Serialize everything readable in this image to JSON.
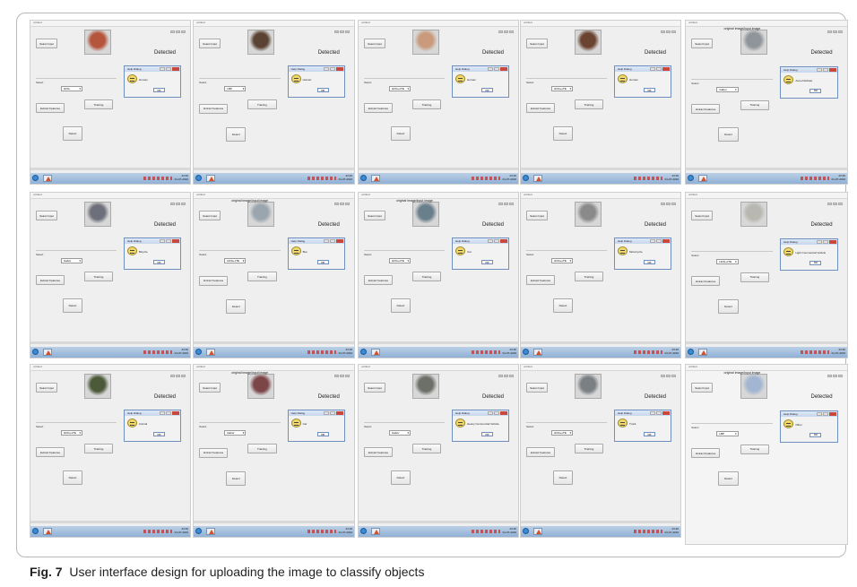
{
  "caption": {
    "fig_label": "Fig. 7",
    "text": "User interface design for uploading the image to classify objects"
  },
  "ui": {
    "window_title": "untitled",
    "select_input": "Select Input",
    "select_label": "Select",
    "extract_features": "Extract Features",
    "training": "Training",
    "detect": "Detect",
    "detected": "Detected",
    "dialog_title": "Help Dialog",
    "ok": "OK",
    "clock_time": "23:30",
    "clock_date": "01-07-2016"
  },
  "panels": [
    {
      "dropdown": "HOG",
      "msg": "Human",
      "top_caption": "",
      "photo": "face1"
    },
    {
      "dropdown": "LBP",
      "msg": "Human",
      "top_caption": "",
      "photo": "face2"
    },
    {
      "dropdown": "HOG+LTE",
      "msg": "Human",
      "top_caption": "",
      "photo": "face3"
    },
    {
      "dropdown": "HOG+LTE",
      "msg": "Human",
      "top_caption": "",
      "photo": "face4"
    },
    {
      "dropdown": "Gabor",
      "msg": "Auto-rickshaw",
      "top_caption": "original image/input image",
      "photo": "auto"
    },
    {
      "dropdown": "Gabor",
      "msg": "Bicycle",
      "top_caption": "",
      "photo": "bike"
    },
    {
      "dropdown": "HOG+LTE",
      "msg": "Bus",
      "top_caption": "original image/input image",
      "photo": "bus"
    },
    {
      "dropdown": "HOG+LTE",
      "msg": "Car",
      "top_caption": "original image/input image",
      "photo": "car"
    },
    {
      "dropdown": "HOG+LTE",
      "msg": "Motorcycle",
      "top_caption": "",
      "photo": "moto"
    },
    {
      "dropdown": "HOG+LTE",
      "msg": "Light Commercial Vehicle",
      "top_caption": "",
      "photo": "van"
    },
    {
      "dropdown": "HOG+LTE",
      "msg": "Animal",
      "top_caption": "",
      "photo": "animal"
    },
    {
      "dropdown": "Gabor",
      "msg": "Car",
      "top_caption": "original image/input image",
      "photo": "redcar"
    },
    {
      "dropdown": "Gabor",
      "msg": "Heavy Commercial Vehicle",
      "top_caption": "",
      "photo": "truck"
    },
    {
      "dropdown": "HOG+LTE",
      "msg": "Truck",
      "top_caption": "",
      "photo": "truck2"
    },
    {
      "dropdown": "LBP",
      "msg": "Other",
      "top_caption": "original image/input image",
      "photo": "flower"
    }
  ],
  "photo_colors": {
    "face1": "#b4553c",
    "face2": "#5a4332",
    "face3": "#c99a7c",
    "face4": "#6b4431",
    "auto": "#8f959a",
    "bike": "#6d6f7a",
    "bus": "#9aa5ad",
    "car": "#6a7f8c",
    "moto": "#8a8a8a",
    "van": "#b8b8b0",
    "animal": "#4c5a3a",
    "redcar": "#7c4548",
    "truck": "#6d7068",
    "truck2": "#7a8084",
    "flower": "#a3b6d1"
  }
}
